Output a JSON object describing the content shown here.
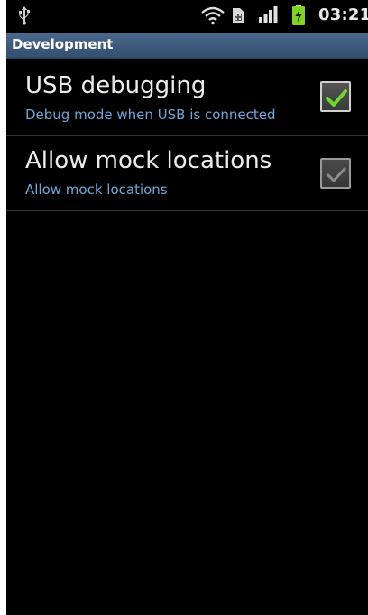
{
  "status_bar": {
    "time": "03:21",
    "icons": [
      "usb-icon",
      "wifi-icon",
      "sim-icon",
      "signal-icon",
      "battery-charging-icon"
    ]
  },
  "header": {
    "title": "Development"
  },
  "settings": [
    {
      "label": "USB debugging",
      "summary": "Debug mode when USB is connected",
      "checked": true,
      "enabled": true
    },
    {
      "label": "Allow mock locations",
      "summary": "Allow mock locations",
      "checked": true,
      "enabled": false
    }
  ],
  "colors": {
    "header_bg": "#3f5b7d",
    "summary_text": "#6fa7d8",
    "check_active": "#6cd92b",
    "check_inactive": "#8a8a8a",
    "battery": "#7fd321"
  }
}
